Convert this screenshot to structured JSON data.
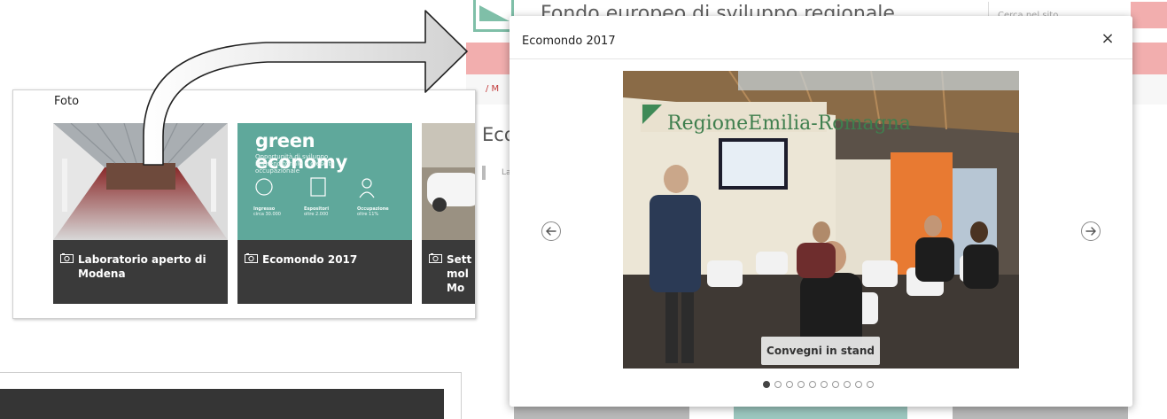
{
  "gallery": {
    "heading": "Foto",
    "cards": [
      {
        "caption_line1": "Laboratorio aperto di",
        "caption_line2": "Modena"
      },
      {
        "caption_line1": "Ecomondo 2017",
        "caption_line2": ""
      },
      {
        "caption_line1": "Sett",
        "caption_line2": "mol",
        "caption_line3": "Mo"
      }
    ],
    "green_card": {
      "title": "green economy",
      "subtitle": "Opportunità di sviluppo imprenditoriale e crescita occupazionale"
    }
  },
  "background_site": {
    "title": "Fondo europeo di sviluppo regionale",
    "search_placeholder": "Cerca nel sito",
    "breadcrumb": "/ M",
    "heading": "Eco",
    "tag": "La"
  },
  "modal": {
    "title": "Ecomondo 2017",
    "close_label": "×",
    "slide_caption": "Convegni in stand",
    "photo_sign": "RegioneEmilia-Romagna",
    "slide_count": 10,
    "active_slide": 0,
    "prev_icon": "arrow-left-icon",
    "next_icon": "arrow-right-icon"
  },
  "colors": {
    "accent_red": "#f2aeae",
    "caption_dark": "#3a3a3a",
    "green_economy": "#5fa89b",
    "logo_green": "#7fbfa8"
  }
}
